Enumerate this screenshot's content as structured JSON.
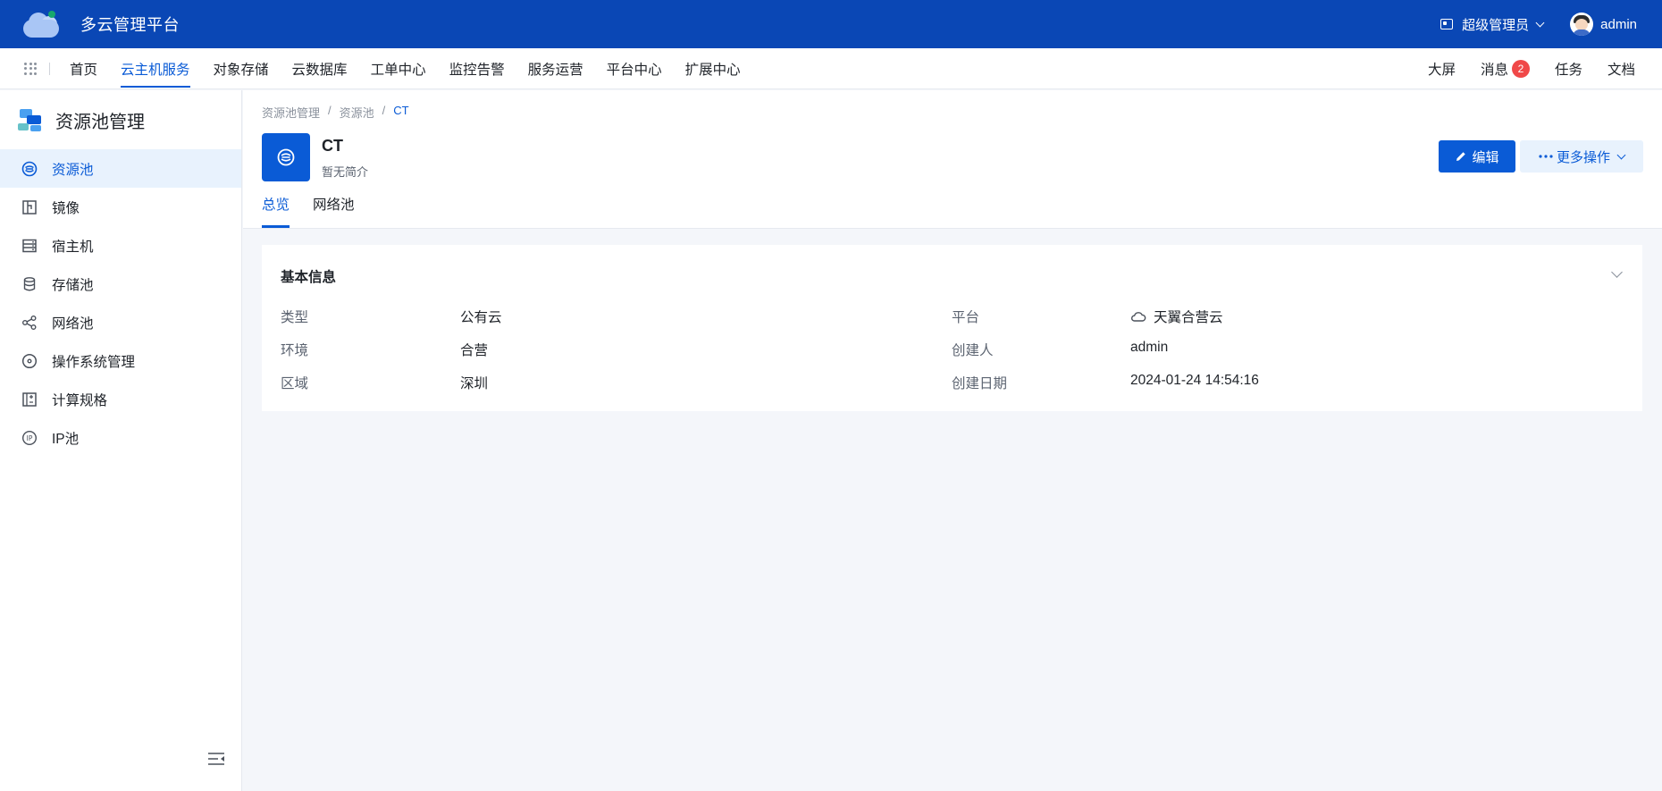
{
  "app": {
    "title": "多云管理平台"
  },
  "header": {
    "role_label": "超级管理员",
    "username": "admin"
  },
  "nav": {
    "items": [
      "首页",
      "云主机服务",
      "对象存储",
      "云数据库",
      "工单中心",
      "监控告警",
      "服务运营",
      "平台中心",
      "扩展中心"
    ],
    "active_index": 1,
    "right": {
      "screen": "大屏",
      "messages": "消息",
      "message_count": "2",
      "tasks": "任务",
      "docs": "文档"
    }
  },
  "sidebar": {
    "title": "资源池管理",
    "items": [
      {
        "label": "资源池",
        "icon": "resource-pool-icon"
      },
      {
        "label": "镜像",
        "icon": "image-icon"
      },
      {
        "label": "宿主机",
        "icon": "host-icon"
      },
      {
        "label": "存储池",
        "icon": "database-icon"
      },
      {
        "label": "网络池",
        "icon": "network-icon"
      },
      {
        "label": "操作系统管理",
        "icon": "disc-icon"
      },
      {
        "label": "计算规格",
        "icon": "spec-icon"
      },
      {
        "label": "IP池",
        "icon": "ip-icon"
      }
    ],
    "active_index": 0
  },
  "breadcrumb": [
    "资源池管理",
    "资源池",
    "CT"
  ],
  "resource": {
    "name": "CT",
    "description": "暂无简介"
  },
  "actions": {
    "edit": "编辑",
    "more": "更多操作"
  },
  "tabs": [
    "总览",
    "网络池"
  ],
  "basic_info": {
    "title": "基本信息",
    "left": [
      {
        "label": "类型",
        "value": "公有云"
      },
      {
        "label": "环境",
        "value": "合营"
      },
      {
        "label": "区域",
        "value": "深圳"
      }
    ],
    "right": [
      {
        "label": "平台",
        "value": "天翼合营云"
      },
      {
        "label": "创建人",
        "value": "admin"
      },
      {
        "label": "创建日期",
        "value": "2024-01-24 14:54:16"
      }
    ]
  },
  "colors": {
    "header_bg": "#0a47b5",
    "accent": "#0a5bd6",
    "badge": "#f04848"
  }
}
